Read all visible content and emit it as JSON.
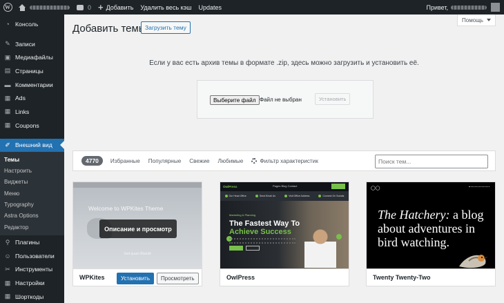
{
  "admin_bar": {
    "comments_count": "0",
    "new_label": "Добавить",
    "cache_label": "Удалить весь кэш",
    "updates_label": "Updates",
    "greeting": "Привет,"
  },
  "sidebar": {
    "items": [
      {
        "label": "Консоль",
        "icon": "dashboard-icon"
      },
      {
        "label": "Записи",
        "icon": "pin-icon"
      },
      {
        "label": "Медиафайлы",
        "icon": "media-icon"
      },
      {
        "label": "Страницы",
        "icon": "page-icon"
      },
      {
        "label": "Комментарии",
        "icon": "comments-icon"
      },
      {
        "label": "Ads",
        "icon": "ads-icon"
      },
      {
        "label": "Links",
        "icon": "links-icon"
      },
      {
        "label": "Coupons",
        "icon": "coupons-icon"
      },
      {
        "label": "Внешний вид",
        "icon": "paintbrush-icon"
      },
      {
        "label": "Плагины",
        "icon": "plugin-icon"
      },
      {
        "label": "Пользователи",
        "icon": "users-icon"
      },
      {
        "label": "Инструменты",
        "icon": "tools-icon"
      },
      {
        "label": "Настройки",
        "icon": "settings-icon"
      },
      {
        "label": "Шорткоды",
        "icon": "shortcodes-icon"
      }
    ],
    "appearance_submenu": [
      "Темы",
      "Настроить",
      "Виджеты",
      "Меню",
      "Typography",
      "Astra Options",
      "Редактор"
    ]
  },
  "help_button": "Помощь",
  "page": {
    "title": "Добавить темы",
    "upload_button": "Загрузить тему",
    "upload_help": "Если у вас есть архив темы в формате .zip, здесь можно загрузить и установить её.",
    "choose_file": "Выберите файл",
    "no_file": "Файл не выбран",
    "install": "Установить"
  },
  "filter_bar": {
    "count": "4770",
    "tabs": [
      "Избранные",
      "Популярные",
      "Свежие",
      "Любимые"
    ],
    "feature_filter": "Фильтр характеристик",
    "search_placeholder": "Поиск тем..."
  },
  "themes": [
    {
      "name": "WPKites",
      "screenshot_title": "Welcome to WPKites Theme",
      "screenshot_sub": "Sed quam Blandit",
      "preview_overlay": "Описание и просмотр",
      "install": "Установить",
      "preview": "Просмотреть"
    },
    {
      "name": "OwlPress",
      "logo": "OwlPress",
      "nav": "Pages  Blog  Contact",
      "info": [
        "Our Head Office",
        "Send Email Us",
        "Visit Office Address",
        "Connect On Socials"
      ],
      "kicker": "Marketing & Planning",
      "headline1": "The Fastest Way To",
      "headline2": "Achieve Success"
    },
    {
      "name": "Twenty Twenty-Two",
      "headline_italic": "The Hatchery:",
      "headline_rest": " a blog about adventures in bird watching."
    }
  ],
  "colors": {
    "admin_dark": "#1d2327",
    "accent_blue": "#2271b1",
    "owl_green": "#78c04b"
  }
}
